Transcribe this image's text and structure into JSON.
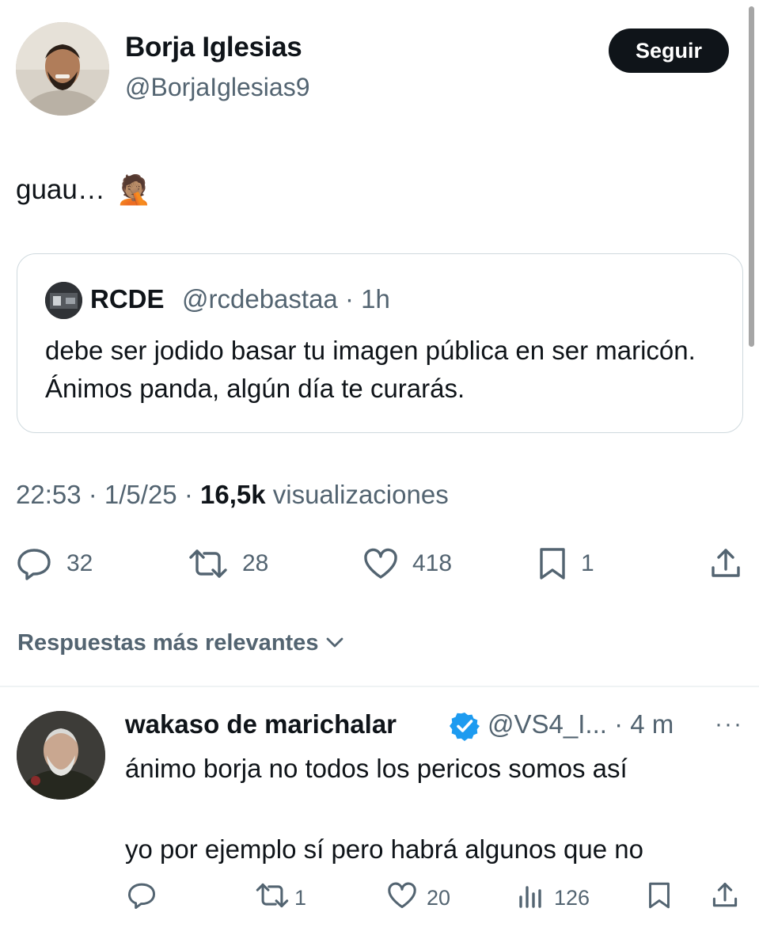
{
  "author": {
    "name": "Borja Iglesias",
    "handle": "@BorjaIglesias9",
    "follow_label": "Seguir"
  },
  "tweet": {
    "text": "guau…",
    "emoji": "🤦🏽",
    "emoji_icon": "face-palm-emoji"
  },
  "quoted": {
    "name": "RCDE",
    "handle_time": "@rcdebastaa · 1h",
    "text": "debe ser jodido basar tu imagen pública en ser maricón. Ánimos panda, algún día te curarás."
  },
  "meta": {
    "time_date": "22:53 · 1/5/25 · ",
    "views_count": "16,5k",
    "views_label": " visualizaciones"
  },
  "actions": {
    "replies": "32",
    "reposts": "28",
    "likes": "418",
    "bookmarks": "1"
  },
  "sort": {
    "label": "Respuestas más relevantes"
  },
  "reply": {
    "name": "wakaso de marichalar",
    "handle_time": "@VS4_I... · 4 m",
    "more": "···",
    "line1": "ánimo borja no todos los pericos somos así",
    "line2": "yo por ejemplo sí pero habrá algunos que no",
    "reposts": "1",
    "likes": "20",
    "views": "126"
  },
  "colors": {
    "text": "#0f1419",
    "secondary": "#536471",
    "border": "#cfd9de",
    "verified": "#1d9bf0",
    "button_bg": "#0f1419"
  }
}
